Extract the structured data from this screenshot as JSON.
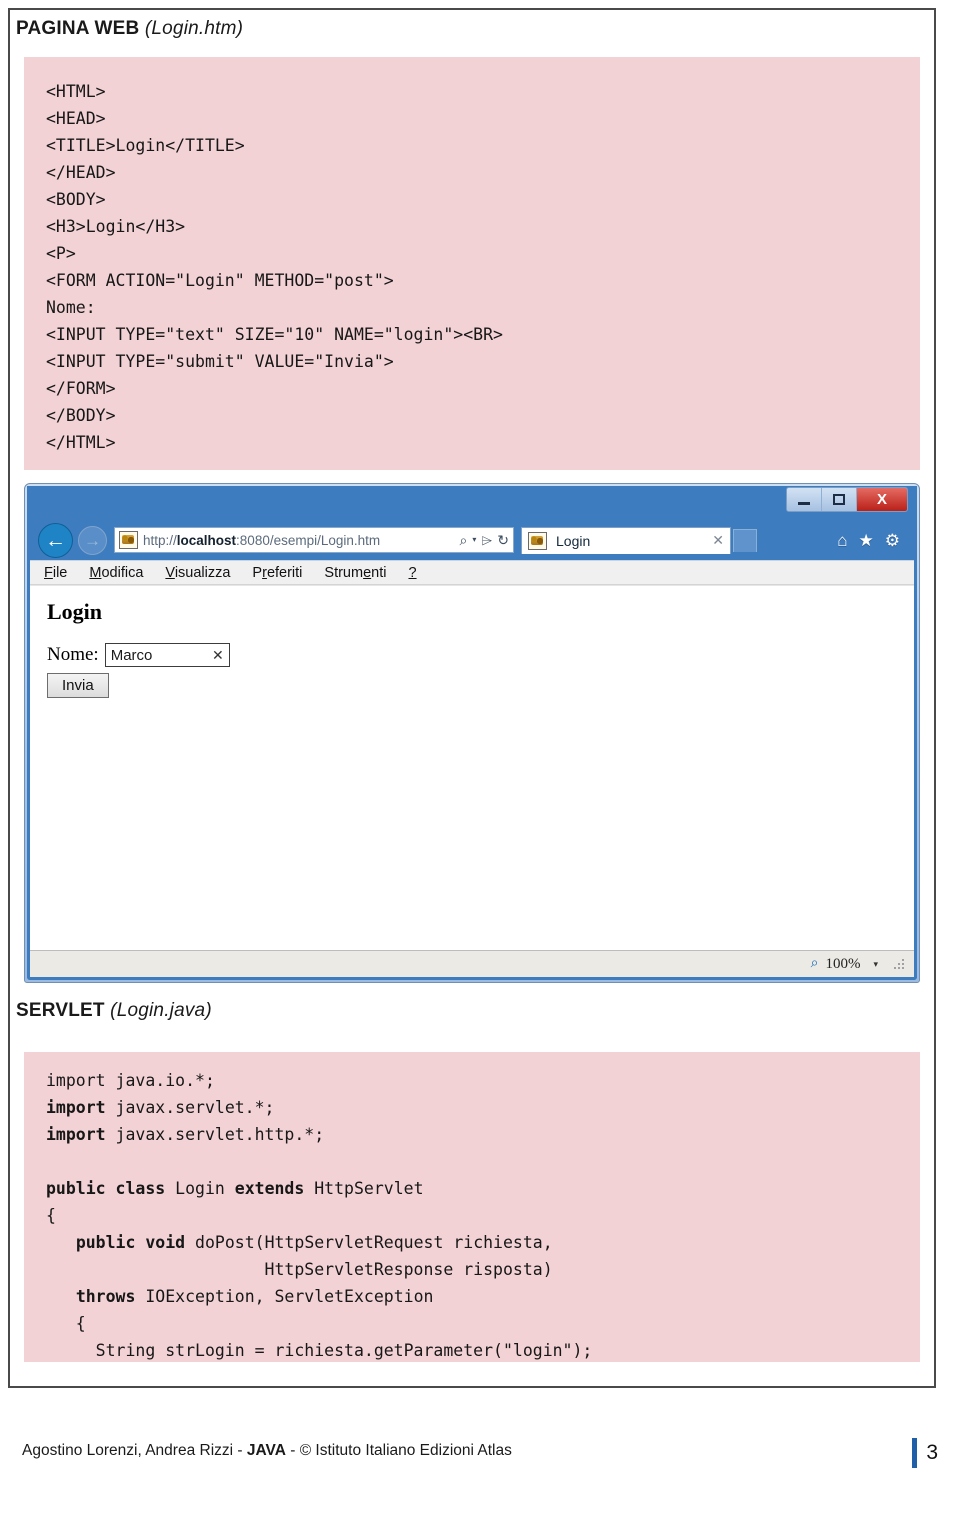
{
  "sections": {
    "web": {
      "label": "PAGINA WEB",
      "filename": "(Login.htm)",
      "code": "<HTML>\n<HEAD>\n<TITLE>Login</TITLE>\n</HEAD>\n<BODY>\n<H3>Login</H3>\n<P>\n<FORM ACTION=\"Login\" METHOD=\"post\">\nNome:\n<INPUT TYPE=\"text\" SIZE=\"10\" NAME=\"login\"><BR>\n<INPUT TYPE=\"submit\" VALUE=\"Invia\">\n</FORM>\n</BODY>\n</HTML>"
    },
    "servlet": {
      "label": "SERVLET",
      "filename": "(Login.java)",
      "code": "import java.io.*;\nimport javax.servlet.*;\nimport javax.servlet.http.*;\n\npublic class Login extends HttpServlet\n{\n   public void doPost(HttpServletRequest richiesta,\n                      HttpServletResponse risposta)\n   throws IOException, ServletException\n   {\n     String strLogin = richiesta.getParameter(\"login\");"
    }
  },
  "browser": {
    "window_buttons": {
      "minimize": "–",
      "maximize": "❐",
      "close": "X"
    },
    "nav": {
      "back": "←",
      "forward": "→"
    },
    "address": {
      "url_prefix": "http://",
      "url_host": "localhost",
      "url_rest": ":8080/esempi/Login.htm",
      "full_url": "http://localhost:8080/esempi/Login.htm",
      "search_icon": "⌕",
      "caret_icon": "▾",
      "compat_icon": "⌲",
      "refresh_icon": "↻"
    },
    "tab": {
      "title": "Login",
      "close": "✕"
    },
    "command_icons": {
      "home": "⌂",
      "favorites": "★",
      "tools": "⚙"
    },
    "menu": [
      {
        "pre": "",
        "key": "F",
        "post": "ile"
      },
      {
        "pre": "",
        "key": "M",
        "post": "odifica"
      },
      {
        "pre": "",
        "key": "V",
        "post": "isualizza"
      },
      {
        "pre": "P",
        "key": "r",
        "post": "eferiti"
      },
      {
        "pre": "Strum",
        "key": "e",
        "post": "nti"
      },
      {
        "pre": "",
        "key": "?",
        "post": ""
      }
    ],
    "document": {
      "heading": "Login",
      "field_label": "Nome:",
      "field_value": "Marco",
      "field_clear": "✕",
      "submit_label": "Invia"
    },
    "statusbar": {
      "zoom_icon": "⌕",
      "zoom_level": "100%",
      "zoom_caret": "▾"
    }
  },
  "footer": {
    "credit_pre": "Agostino Lorenzi, Andrea Rizzi - ",
    "credit_bold": "JAVA",
    "credit_post": " - © Istituto Italiano Edizioni Atlas",
    "page_number": "3"
  },
  "colors": {
    "code_background": "#f2d2d5",
    "page_border": "#4a4a4a",
    "browser_chrome": "#3e7cc0",
    "close_button": "#b92018",
    "page_rule": "#1f5fa8"
  }
}
